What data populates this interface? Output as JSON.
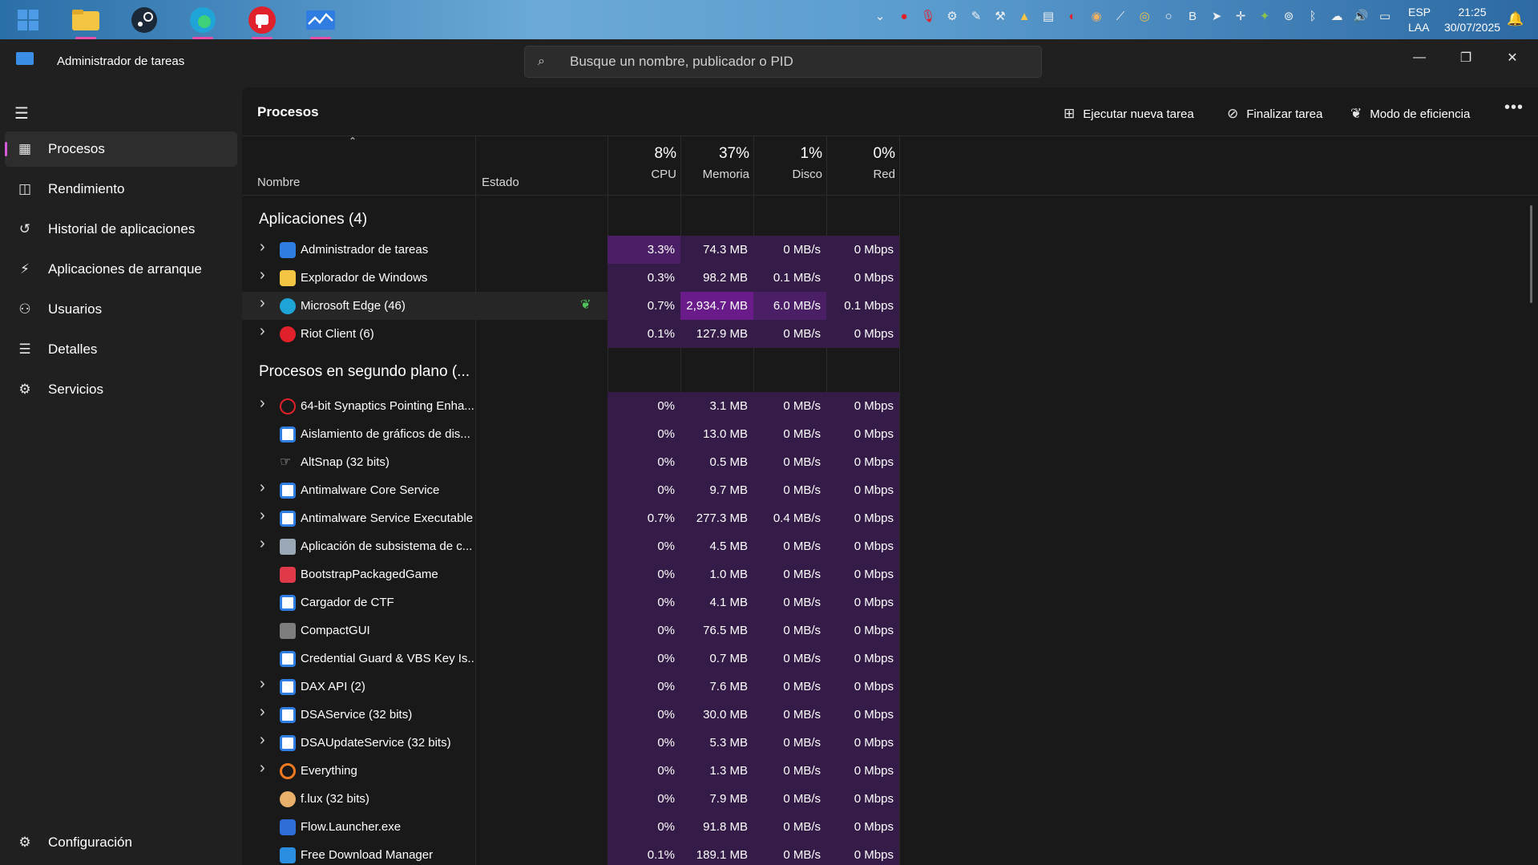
{
  "taskbar": {
    "apps": [
      {
        "name": "start",
        "color": "#3d85cf"
      },
      {
        "name": "file-explorer",
        "color": "#f4c542"
      },
      {
        "name": "steam",
        "color": "#1b2838"
      },
      {
        "name": "edge",
        "color": "#1fa4d8"
      },
      {
        "name": "riot-client",
        "color": "#e0202a"
      },
      {
        "name": "task-manager",
        "color": "#2f7de0"
      }
    ],
    "lang_top": "ESP",
    "lang_bottom": "LAA",
    "time": "21:25",
    "date": "30/07/2025"
  },
  "titlebar": {
    "title": "Administrador de tareas",
    "search_placeholder": "Busque un nombre, publicador o PID"
  },
  "sidebar": {
    "items": [
      {
        "label": "Procesos",
        "icon": "processes-icon",
        "active": true
      },
      {
        "label": "Rendimiento",
        "icon": "performance-icon",
        "active": false
      },
      {
        "label": "Historial de aplicaciones",
        "icon": "history-icon",
        "active": false
      },
      {
        "label": "Aplicaciones de arranque",
        "icon": "startup-icon",
        "active": false
      },
      {
        "label": "Usuarios",
        "icon": "users-icon",
        "active": false
      },
      {
        "label": "Detalles",
        "icon": "details-icon",
        "active": false
      },
      {
        "label": "Servicios",
        "icon": "services-icon",
        "active": false
      }
    ],
    "settings_label": "Configuración"
  },
  "main": {
    "title": "Procesos",
    "commands": {
      "run_new_task": "Ejecutar nueva tarea",
      "end_task": "Finalizar tarea",
      "efficiency_mode": "Modo de eficiencia"
    },
    "columns": {
      "name": "Nombre",
      "status": "Estado",
      "cpu_pct": "8%",
      "cpu_label": "CPU",
      "mem_pct": "37%",
      "mem_label": "Memoria",
      "disk_pct": "1%",
      "disk_label": "Disco",
      "net_pct": "0%",
      "net_label": "Red"
    },
    "groups": {
      "apps": "Aplicaciones (4)",
      "background": "Procesos en segundo plano (..."
    },
    "apps": [
      {
        "name": "Administrador de tareas",
        "expand": true,
        "icon": "task-manager-icon",
        "cpu": "3.3%",
        "mem": "74.3 MB",
        "disk": "0 MB/s",
        "net": "0 Mbps"
      },
      {
        "name": "Explorador de Windows",
        "expand": true,
        "icon": "folder-icon",
        "cpu": "0.3%",
        "mem": "98.2 MB",
        "disk": "0.1 MB/s",
        "net": "0 Mbps"
      },
      {
        "name": "Microsoft Edge (46)",
        "expand": true,
        "icon": "edge-icon",
        "cpu": "0.7%",
        "mem": "2,934.7 MB",
        "disk": "6.0 MB/s",
        "net": "0.1 Mbps",
        "efficiency": true
      },
      {
        "name": "Riot Client (6)",
        "expand": true,
        "icon": "riot-icon",
        "cpu": "0.1%",
        "mem": "127.9 MB",
        "disk": "0 MB/s",
        "net": "0 Mbps"
      }
    ],
    "background": [
      {
        "name": "64-bit Synaptics Pointing Enha...",
        "expand": true,
        "icon": "synaptics-icon",
        "cpu": "0%",
        "mem": "3.1 MB",
        "disk": "0 MB/s",
        "net": "0 Mbps"
      },
      {
        "name": "Aislamiento de gráficos de dis...",
        "expand": false,
        "icon": "window-icon",
        "cpu": "0%",
        "mem": "13.0 MB",
        "disk": "0 MB/s",
        "net": "0 Mbps"
      },
      {
        "name": "AltSnap (32 bits)",
        "expand": false,
        "icon": "altsnap-icon",
        "cpu": "0%",
        "mem": "0.5 MB",
        "disk": "0 MB/s",
        "net": "0 Mbps"
      },
      {
        "name": "Antimalware Core Service",
        "expand": true,
        "icon": "window-icon",
        "cpu": "0%",
        "mem": "9.7 MB",
        "disk": "0 MB/s",
        "net": "0 Mbps"
      },
      {
        "name": "Antimalware Service Executable",
        "expand": true,
        "icon": "window-icon",
        "cpu": "0.7%",
        "mem": "277.3 MB",
        "disk": "0.4 MB/s",
        "net": "0 Mbps"
      },
      {
        "name": "Aplicación de subsistema de c...",
        "expand": true,
        "icon": "subsystem-icon",
        "cpu": "0%",
        "mem": "4.5 MB",
        "disk": "0 MB/s",
        "net": "0 Mbps"
      },
      {
        "name": "BootstrapPackagedGame",
        "expand": false,
        "icon": "bootstrap-icon",
        "cpu": "0%",
        "mem": "1.0 MB",
        "disk": "0 MB/s",
        "net": "0 Mbps"
      },
      {
        "name": "Cargador de CTF",
        "expand": false,
        "icon": "window-icon",
        "cpu": "0%",
        "mem": "4.1 MB",
        "disk": "0 MB/s",
        "net": "0 Mbps"
      },
      {
        "name": "CompactGUI",
        "expand": false,
        "icon": "compactgui-icon",
        "cpu": "0%",
        "mem": "76.5 MB",
        "disk": "0 MB/s",
        "net": "0 Mbps"
      },
      {
        "name": "Credential Guard & VBS Key Is...",
        "expand": false,
        "icon": "window-icon",
        "cpu": "0%",
        "mem": "0.7 MB",
        "disk": "0 MB/s",
        "net": "0 Mbps"
      },
      {
        "name": "DAX API (2)",
        "expand": true,
        "icon": "window-icon",
        "cpu": "0%",
        "mem": "7.6 MB",
        "disk": "0 MB/s",
        "net": "0 Mbps"
      },
      {
        "name": "DSAService (32 bits)",
        "expand": true,
        "icon": "window-icon",
        "cpu": "0%",
        "mem": "30.0 MB",
        "disk": "0 MB/s",
        "net": "0 Mbps"
      },
      {
        "name": "DSAUpdateService (32 bits)",
        "expand": true,
        "icon": "window-icon",
        "cpu": "0%",
        "mem": "5.3 MB",
        "disk": "0 MB/s",
        "net": "0 Mbps"
      },
      {
        "name": "Everything",
        "expand": true,
        "icon": "everything-icon",
        "cpu": "0%",
        "mem": "1.3 MB",
        "disk": "0 MB/s",
        "net": "0 Mbps"
      },
      {
        "name": "f.lux (32 bits)",
        "expand": false,
        "icon": "flux-icon",
        "cpu": "0%",
        "mem": "7.9 MB",
        "disk": "0 MB/s",
        "net": "0 Mbps"
      },
      {
        "name": "Flow.Launcher.exe",
        "expand": false,
        "icon": "flow-launcher-icon",
        "cpu": "0%",
        "mem": "91.8 MB",
        "disk": "0 MB/s",
        "net": "0 Mbps"
      },
      {
        "name": "Free Download Manager",
        "expand": false,
        "icon": "fdm-icon",
        "cpu": "0.1%",
        "mem": "189.1 MB",
        "disk": "0 MB/s",
        "net": "0 Mbps"
      }
    ]
  },
  "colors": {
    "accent": "#d65ad9",
    "heat_low": "#351c48",
    "heat_mid": "#4b1f66",
    "heat_high": "#6a1b8a",
    "efficiency_leaf": "#4fc35a"
  }
}
